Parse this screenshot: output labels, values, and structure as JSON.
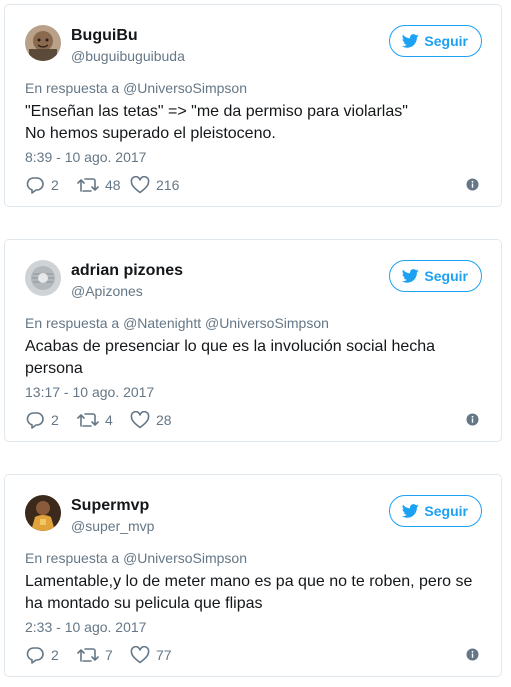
{
  "colors": {
    "accent": "#1da1f2",
    "secondary_text": "#657786",
    "primary_text": "#14171a",
    "border": "#e1e8ed"
  },
  "tweets": [
    {
      "name": "BuguiBu",
      "handle": "@buguibuguibuda",
      "follow_label": "Seguir",
      "reply_prefix": "En respuesta a",
      "mentions": "@UniversoSimpson",
      "text_lines": [
        "\"Enseñan las tetas\" => \"me da permiso para violarlas\"",
        "No hemos superado el pleistoceno."
      ],
      "timestamp": "8:39 - 10 ago. 2017",
      "replies": "2",
      "retweets": "48",
      "likes": "216",
      "avatar_icon": "profile-photo"
    },
    {
      "name": "adrian pizones",
      "handle": "@Apizones",
      "follow_label": "Seguir",
      "reply_prefix": "En respuesta a",
      "mentions": "@Natenightt @UniversoSimpson",
      "text_lines": [
        "Acabas de presenciar lo que es la involución social hecha",
        "persona"
      ],
      "timestamp": "13:17 - 10 ago. 2017",
      "replies": "2",
      "retweets": "4",
      "likes": "28",
      "avatar_icon": "profile-photo"
    },
    {
      "name": "Supermvp",
      "handle": "@super_mvp",
      "follow_label": "Seguir",
      "reply_prefix": "En respuesta a",
      "mentions": "@UniversoSimpson",
      "text_lines": [
        "Lamentable,y lo de meter mano es pa que no te roben, pero se",
        "ha montado su pelicula que flipas"
      ],
      "timestamp": "2:33 - 10 ago. 2017",
      "replies": "2",
      "retweets": "7",
      "likes": "77",
      "avatar_icon": "profile-photo"
    }
  ]
}
